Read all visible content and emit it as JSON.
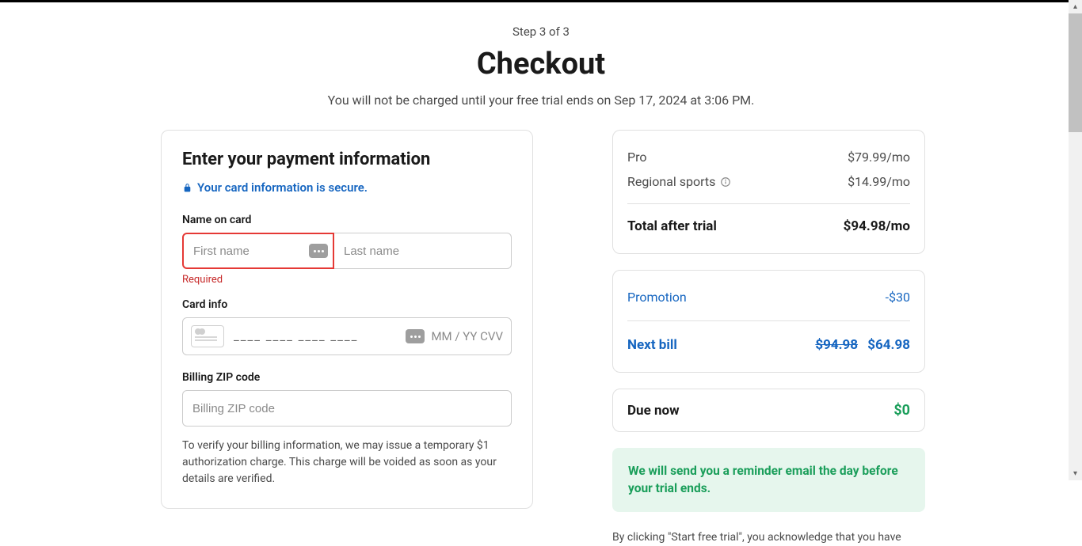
{
  "header": {
    "step": "Step 3 of 3",
    "title": "Checkout",
    "subtitle": "You will not be charged until your free trial ends on Sep 17, 2024 at 3:06 PM."
  },
  "payment": {
    "heading": "Enter your payment information",
    "secure": "Your card information is secure.",
    "name_label": "Name on card",
    "first_placeholder": "First name",
    "last_placeholder": "Last name",
    "required_error": "Required",
    "card_label": "Card info",
    "card_slots": "____  ____  ____  ____",
    "exp_cvv": "MM / YY CVV",
    "zip_label": "Billing ZIP code",
    "zip_placeholder": "Billing ZIP code",
    "billing_note": "To verify your billing information, we may issue a temporary $1 authorization charge. This charge will be voided as soon as your details are verified."
  },
  "summary": {
    "items": [
      {
        "label": "Pro",
        "price": "$79.99/mo",
        "info": false
      },
      {
        "label": "Regional sports",
        "price": "$14.99/mo",
        "info": true
      }
    ],
    "total_label": "Total after trial",
    "total_value": "$94.98/mo"
  },
  "promo": {
    "label": "Promotion",
    "value": "-$30",
    "nextbill_label": "Next bill",
    "nextbill_strike": "$94.98",
    "nextbill_value": "$64.98"
  },
  "due": {
    "label": "Due now",
    "value": "$0"
  },
  "reminder": "We will send you a reminder email the day before your trial ends.",
  "legal": "By clicking \"Start free trial\", you acknowledge that you have"
}
